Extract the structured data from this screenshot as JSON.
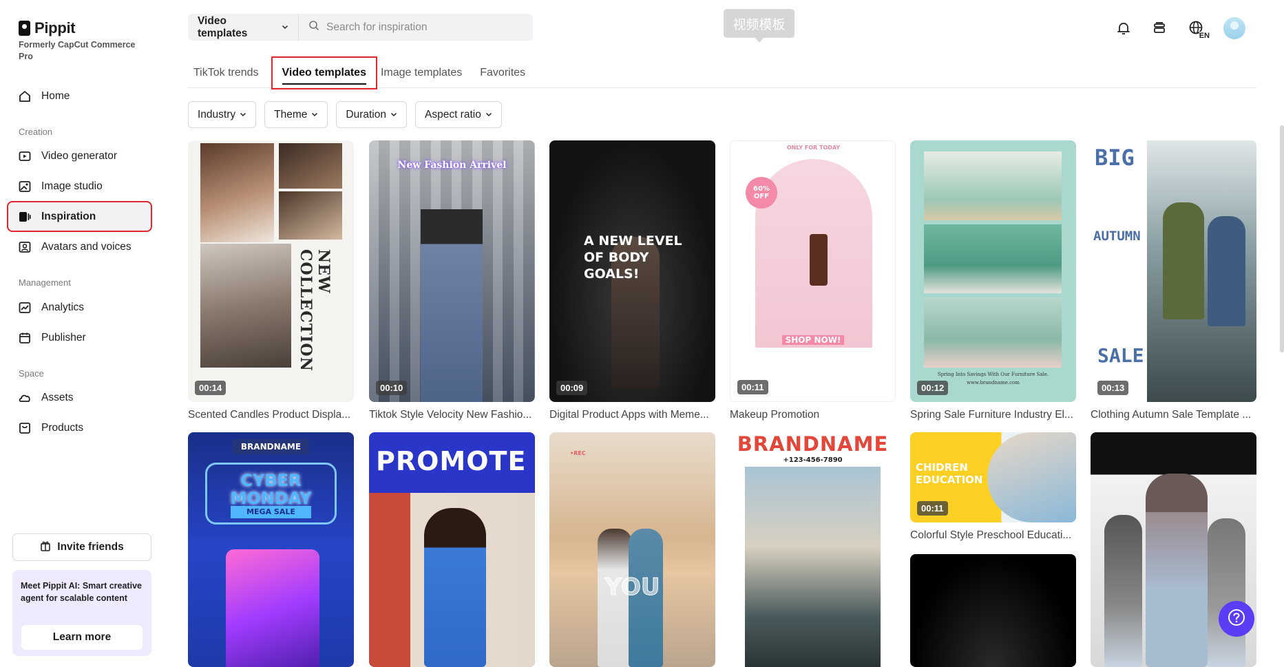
{
  "brand": {
    "name": "Pippit",
    "subtitle": "Formerly CapCut Commerce Pro"
  },
  "sidebar": {
    "home": "Home",
    "sections": {
      "creation": "Creation",
      "management": "Management",
      "space": "Space"
    },
    "creation_items": [
      "Video generator",
      "Image studio",
      "Inspiration",
      "Avatars and voices"
    ],
    "management_items": [
      "Analytics",
      "Publisher"
    ],
    "space_items": [
      "Assets",
      "Products"
    ],
    "active_item": "Inspiration",
    "invite": "Invite friends",
    "promo": {
      "text": "Meet Pippit AI: Smart creative agent for scalable content",
      "button": "Learn more"
    }
  },
  "search": {
    "scope": "Video templates",
    "placeholder": "Search for inspiration"
  },
  "tooltip": "视频模板",
  "tabs": [
    "TikTok trends",
    "Video templates",
    "Image templates",
    "Favorites"
  ],
  "active_tab": "Video templates",
  "filters": [
    "Industry",
    "Theme",
    "Duration",
    "Aspect ratio"
  ],
  "language": "EN",
  "templates": [
    {
      "title": "Scented Candles Product Displa...",
      "duration": "00:14",
      "overlay": "NEW COLLECTION"
    },
    {
      "title": "Tiktok Style Velocity New Fashio...",
      "duration": "00:10",
      "overlay": "New Fashion Arrivel"
    },
    {
      "title": "Digital Product Apps with Meme...",
      "duration": "00:09",
      "overlay": "A NEW LEVEL OF BODY GOALS!"
    },
    {
      "title": "Makeup Promotion",
      "duration": "00:11",
      "overlay_top": "ONLY FOR TODAY",
      "overlay_badge": "60% OFF",
      "overlay_bottom": "SHOP NOW!"
    },
    {
      "title": "Spring Sale Furniture Industry El...",
      "duration": "00:12",
      "overlay": "Spring Into Savings With Our Furniture Sale.",
      "overlay_url": "www.brandname.com"
    },
    {
      "title": "Clothing Autumn Sale Template ...",
      "duration": "00:13",
      "overlay_top": "BIG",
      "overlay_mid": "AUTUMN",
      "overlay_bottom": "SALE"
    },
    {
      "overlay_top": "BRANDNAME",
      "overlay_mid": "CYBER MONDAY",
      "overlay_bottom": "MEGA SALE"
    },
    {
      "overlay": "PROMOTE"
    },
    {
      "overlay": "YOU",
      "overlay_rec": "•REC"
    },
    {
      "overlay": "BRANDNAME",
      "overlay_phone": "+123-456-7890"
    },
    {
      "title": "Colorful Style Preschool Educati...",
      "duration": "00:11",
      "overlay": "CHIDREN EDUCATION"
    },
    {}
  ],
  "colors": {
    "highlight": "#e1262c",
    "help": "#5b3df5",
    "promo_bg": "#efeaff"
  }
}
